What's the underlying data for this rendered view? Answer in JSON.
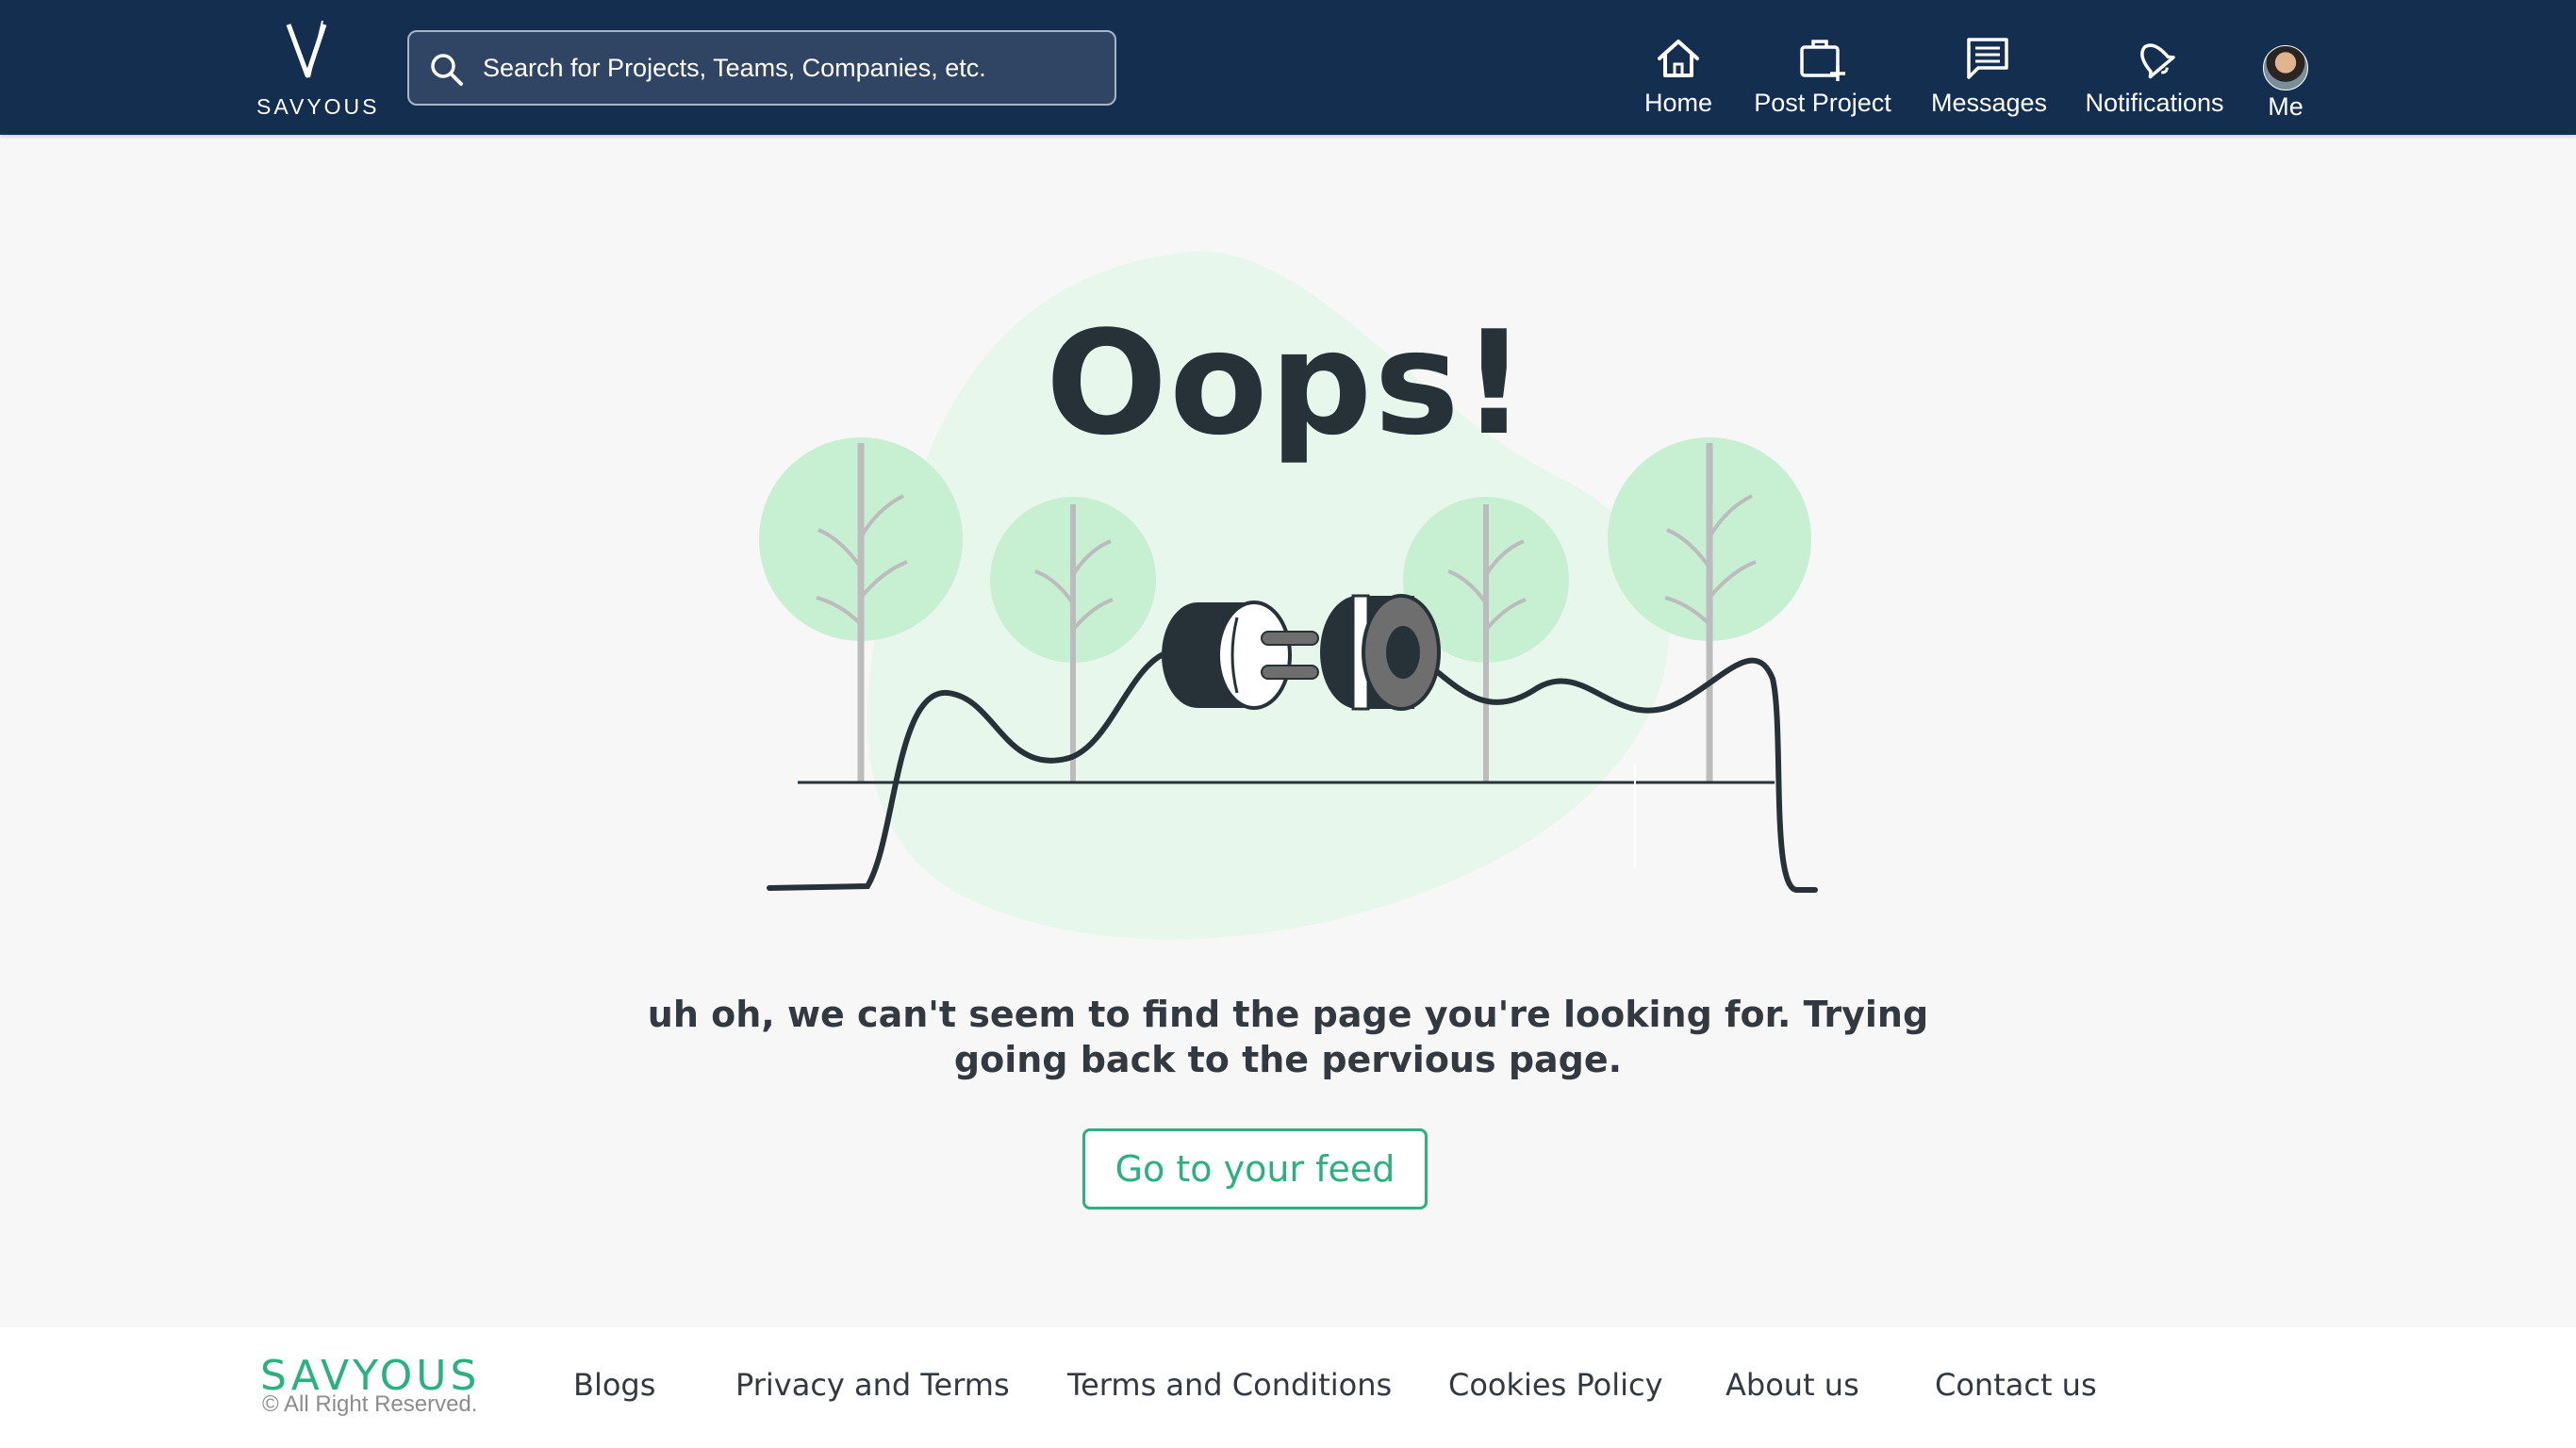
{
  "header": {
    "logo_text": "SAVYOUS",
    "search": {
      "placeholder": "Search for Projects, Teams, Companies, etc."
    },
    "nav": [
      {
        "label": "Home",
        "icon": "home-icon"
      },
      {
        "label": "Post Project",
        "icon": "briefcase-plus-icon"
      },
      {
        "label": "Messages",
        "icon": "message-icon"
      },
      {
        "label": "Notifications",
        "icon": "bell-icon"
      },
      {
        "label": "Me",
        "icon": "avatar"
      }
    ]
  },
  "main": {
    "title": "Oops!",
    "message": "uh oh, we can't seem to find the page you're looking for. Trying going back to the pervious page.",
    "button_label": "Go to your feed"
  },
  "footer": {
    "logo_text": "SAVYOUS",
    "copyright": "© All Right Reserved.",
    "links": [
      "Blogs",
      "Privacy and Terms",
      "Terms and Conditions",
      "Cookies Policy",
      "About us",
      "Contact us"
    ]
  },
  "colors": {
    "header_bg": "#142e50",
    "accent": "#2bb07f",
    "blob": "#e8f7ec",
    "tree": "#c7efd2",
    "text_dark": "#263238"
  }
}
